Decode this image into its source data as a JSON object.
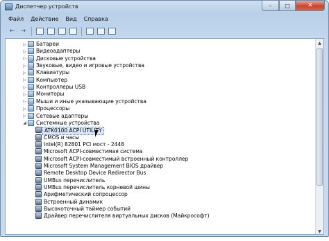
{
  "window": {
    "title": "Диспетчер устройств",
    "minimize_label": "–",
    "maximize_label": "□",
    "close_label": "✕"
  },
  "menu": [
    "Файл",
    "Действие",
    "Вид",
    "Справка"
  ],
  "toolbar": {
    "back_icon": "←",
    "forward_icon": "→"
  },
  "tree": {
    "categories": [
      {
        "label": "Батареи",
        "expander": "▷"
      },
      {
        "label": "Видеоадаптеры",
        "expander": "▷"
      },
      {
        "label": "Дисковые устройства",
        "expander": "▷"
      },
      {
        "label": "Звуковые, видео и игровые устройства",
        "expander": "▷"
      },
      {
        "label": "Клавиатуры",
        "expander": "▷"
      },
      {
        "label": "Компьютер",
        "expander": "▷"
      },
      {
        "label": "Контроллеры USB",
        "expander": "▷"
      },
      {
        "label": "Мониторы",
        "expander": "▷"
      },
      {
        "label": "Мыши и иные указывающие устройства",
        "expander": "▷"
      },
      {
        "label": "Процессоры",
        "expander": "▷"
      },
      {
        "label": "Сетевые адаптеры",
        "expander": "▷"
      },
      {
        "label": "Системные устройства",
        "expander": "◢"
      }
    ],
    "system_devices": [
      {
        "label": "ATK0100 ACPI UTILITY",
        "selected": true
      },
      {
        "label": "CMOS и часы",
        "selected": false
      },
      {
        "label": "Intel(R) 82801 PCI мост - 2448",
        "selected": false
      },
      {
        "label": "Microsoft ACPI-совместимая система",
        "selected": false
      },
      {
        "label": "Microsoft ACPI-совместимый встроенный контроллер",
        "selected": false
      },
      {
        "label": "Microsoft System Management BIOS драйвер",
        "selected": false
      },
      {
        "label": "Remote Desktop Device Redirector Bus",
        "selected": false
      },
      {
        "label": "UMBus перечислитель",
        "selected": false
      },
      {
        "label": "UMBus перечислитель корневой шины",
        "selected": false
      },
      {
        "label": "Арифметический сопроцессор",
        "selected": false
      },
      {
        "label": "Встроенный динамик",
        "selected": false
      },
      {
        "label": "Высокоточный таймер событий",
        "selected": false
      },
      {
        "label": "Драйвер перечислителя виртуальных дисков (Майкрософт)",
        "selected": false
      }
    ]
  },
  "scrollbar": {
    "up_arrow": "▲",
    "down_arrow": "▼"
  }
}
